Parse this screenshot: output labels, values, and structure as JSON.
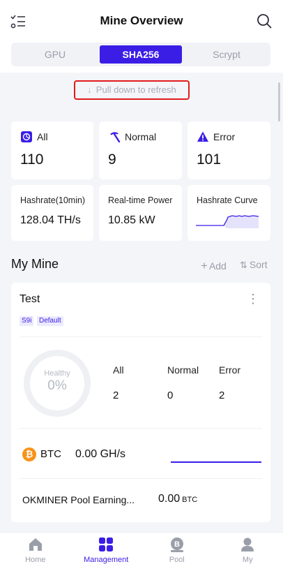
{
  "header": {
    "title": "Mine Overview"
  },
  "algo_tabs": [
    {
      "label": "GPU",
      "active": false
    },
    {
      "label": "SHA256",
      "active": true
    },
    {
      "label": "Scrypt",
      "active": false
    }
  ],
  "refresh_hint": "Pull down to refresh",
  "status": {
    "all": {
      "label": "All",
      "value": "110"
    },
    "normal": {
      "label": "Normal",
      "value": "9"
    },
    "error": {
      "label": "Error",
      "value": "101"
    }
  },
  "metrics": {
    "hashrate": {
      "label": "Hashrate(10min)",
      "value": "128.04 TH/s"
    },
    "power": {
      "label": "Real-time Power",
      "value": "10.85 kW"
    },
    "curve": {
      "label": "Hashrate Curve"
    }
  },
  "my_mine": {
    "title": "My Mine",
    "add_label": "Add",
    "sort_label": "Sort"
  },
  "mine_card": {
    "name": "Test",
    "tags": [
      "S9i",
      "Default"
    ],
    "health": {
      "label": "Healthy",
      "value": "0%"
    },
    "counts": {
      "all": {
        "label": "All",
        "value": "2"
      },
      "normal": {
        "label": "Normal",
        "value": "0"
      },
      "error": {
        "label": "Error",
        "value": "2"
      }
    },
    "coin": {
      "symbol": "₿",
      "name": "BTC",
      "hashrate": "0.00 GH/s"
    },
    "earnings": {
      "label": "OKMINER Pool Earning...",
      "value": "0.00",
      "unit": "BTC"
    }
  },
  "tabbar": [
    {
      "label": "Home",
      "icon": "home-icon",
      "active": false
    },
    {
      "label": "Management",
      "icon": "grid-icon",
      "active": true
    },
    {
      "label": "Pool",
      "icon": "pool-icon",
      "active": false
    },
    {
      "label": "My",
      "icon": "profile-icon",
      "active": false
    }
  ],
  "colors": {
    "accent": "#3a1ee6",
    "error_border": "#e01b1b",
    "btc": "#f7931a"
  }
}
